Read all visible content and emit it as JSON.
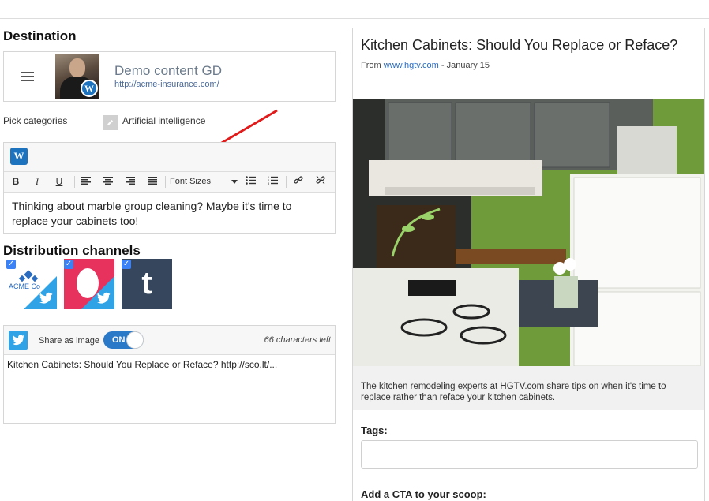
{
  "destination": {
    "heading": "Destination",
    "name": "Demo content GD",
    "url": "http://acme-insurance.com/",
    "menu_icon": "hamburger-icon",
    "badge_icon": "wordpress-icon"
  },
  "categories": {
    "label": "Pick categories",
    "selected": "Artificial intelligence"
  },
  "editor": {
    "font_sizes_label": "Font Sizes",
    "toolbar": [
      "bold",
      "italic",
      "underline",
      "align-left",
      "align-center",
      "align-right",
      "justify",
      "font-sizes",
      "bullet-list",
      "numbered-list",
      "link",
      "unlink"
    ],
    "bold_glyph": "B",
    "italic_glyph": "I",
    "underline_glyph": "U",
    "content": "Thinking about marble group cleaning? Maybe it's time to replace your cabinets too!"
  },
  "distribution": {
    "heading": "Distribution channels",
    "channels": [
      {
        "name": "ACME Co",
        "network": "twitter",
        "checked": true
      },
      {
        "name": "instagram-like",
        "network": "twitter",
        "checked": true
      },
      {
        "name": "tumblr",
        "network": "tumblr",
        "checked": true
      }
    ],
    "acme_logo_text": "ACME Co",
    "tumblr_glyph": "t"
  },
  "share": {
    "label": "Share as image",
    "toggle_text": "ON",
    "toggle_on": true,
    "chars_left": "66 characters left",
    "text": "Kitchen Cabinets: Should You Replace or Reface? http://sco.lt/..."
  },
  "preview": {
    "title": "Kitchen Cabinets: Should You Replace or Reface?",
    "from_label": "From",
    "source": "www.hgtv.com",
    "separator": " - ",
    "date": "January 15",
    "caption": "The kitchen remodeling experts at HGTV.com share tips on when it's time to replace rather than reface your kitchen cabinets.",
    "tags_label": "Tags:",
    "cta_label": "Add a CTA to your scoop:"
  },
  "colors": {
    "accent": "#1e73be",
    "twitter": "#2fa3e6",
    "toggle": "#2a78c8",
    "arrow": "#e01b1b"
  }
}
